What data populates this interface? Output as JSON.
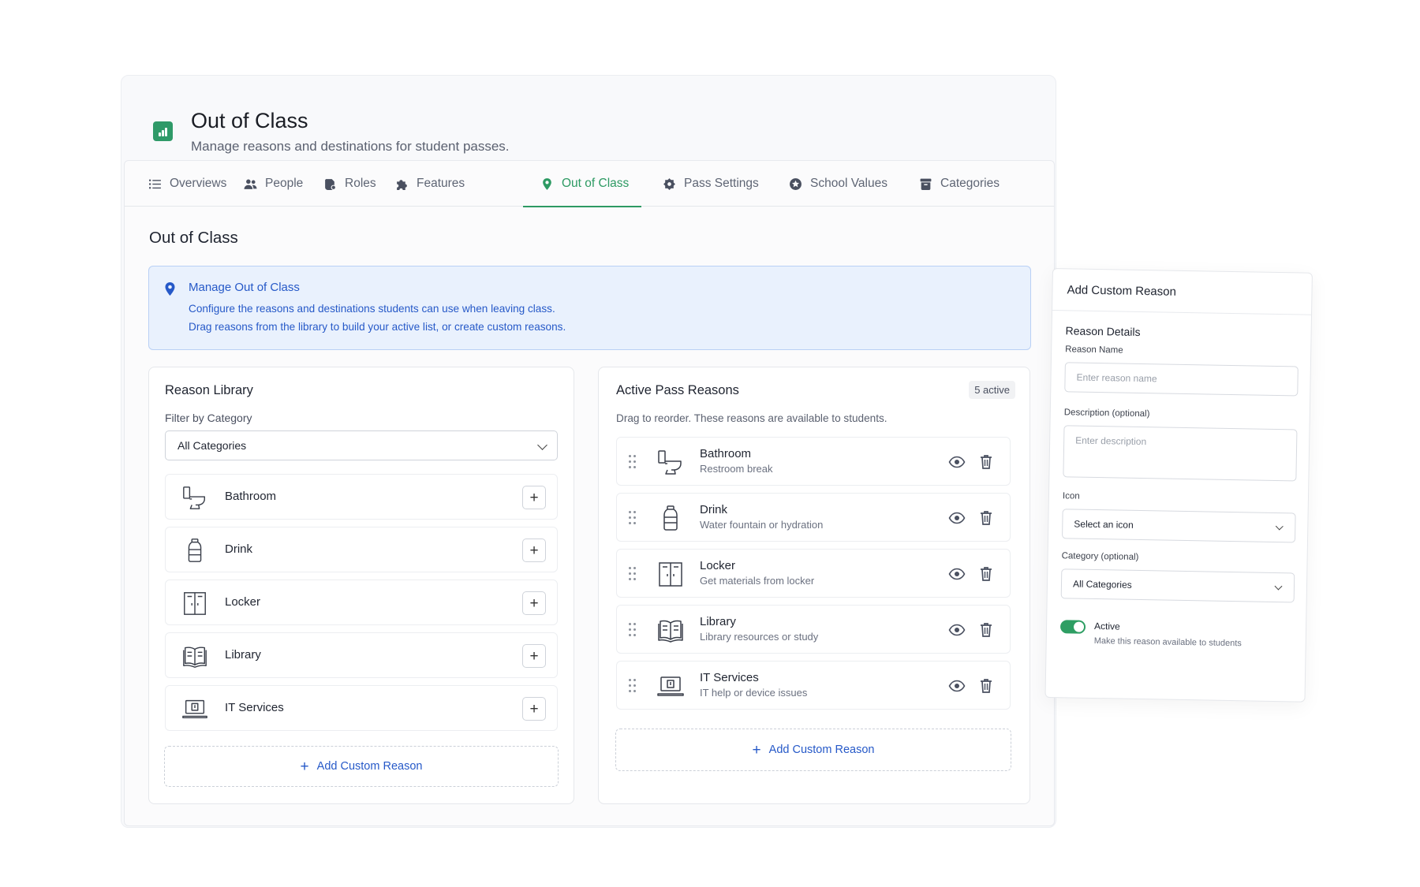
{
  "header": {
    "title": "Out of Class",
    "subtitle": "Manage reasons and destinations for student passes.",
    "icon": "bar-chart-icon",
    "accent_color": "#2d9a63"
  },
  "tabs": [
    {
      "label": "Overviews",
      "icon": "list-icon",
      "active": false
    },
    {
      "label": "People",
      "icon": "people-icon",
      "active": false
    },
    {
      "label": "Roles",
      "icon": "roles-icon",
      "active": false
    },
    {
      "label": "Features",
      "icon": "puzzle-icon",
      "active": false
    },
    {
      "label": "Out of Class",
      "icon": "location-pin-icon",
      "active": true
    },
    {
      "label": "Pass Settings",
      "icon": "gear-icon",
      "active": false
    },
    {
      "label": "School Values",
      "icon": "star-icon",
      "active": false
    },
    {
      "label": "Categories",
      "icon": "archive-icon",
      "active": false
    }
  ],
  "section_title": "Out of Class",
  "info": {
    "title": "Manage Out of Class",
    "line1": "Configure the reasons and destinations students can use when leaving class.",
    "line2": "Drag reasons from the library to build your active list, or create custom reasons."
  },
  "library": {
    "title": "Reason Library",
    "filter_label": "Filter by Category",
    "filter_value": "All Categories",
    "items": [
      {
        "label": "Bathroom",
        "icon": "toilet-icon"
      },
      {
        "label": "Drink",
        "icon": "bottle-icon"
      },
      {
        "label": "Locker",
        "icon": "locker-icon"
      },
      {
        "label": "Library",
        "icon": "book-icon"
      },
      {
        "label": "IT Services",
        "icon": "laptop-icon"
      }
    ],
    "add_label": "Add Custom Reason"
  },
  "active": {
    "title": "Active Pass Reasons",
    "badge": "5 active",
    "subtitle": "Drag to reorder. These reasons are available to students.",
    "items": [
      {
        "name": "Bathroom",
        "desc": "Restroom break",
        "icon": "toilet-icon"
      },
      {
        "name": "Drink",
        "desc": "Water fountain or hydration",
        "icon": "bottle-icon"
      },
      {
        "name": "Locker",
        "desc": "Get materials from locker",
        "icon": "locker-icon"
      },
      {
        "name": "Library",
        "desc": "Library resources or study",
        "icon": "book-icon"
      },
      {
        "name": "IT Services",
        "desc": "IT help or device issues",
        "icon": "laptop-icon"
      }
    ],
    "add_label": "Add Custom Reason"
  },
  "custom_form": {
    "title": "Add Custom Reason",
    "section": "Reason Details",
    "name_label": "Reason Name",
    "name_placeholder": "Enter reason name",
    "desc_label": "Description (optional)",
    "desc_placeholder": "Enter description",
    "icon_label": "Icon",
    "icon_value": "Select an icon",
    "category_label": "Category (optional)",
    "category_value": "All Categories",
    "active_label": "Active",
    "active_sub": "Make this reason available to students",
    "active_on": true
  }
}
